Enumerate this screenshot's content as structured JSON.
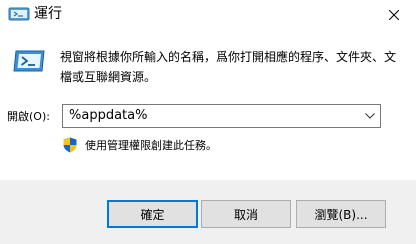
{
  "window": {
    "title": "運行",
    "close_label": "×"
  },
  "dialog": {
    "description": "視窗將根據你所輸入的名稱，爲你打開相應的程序、文件夾、文檔或互聯網資源。",
    "open_label": "開啟(O):",
    "open_value": "%appdata%",
    "admin_note": "使用管理權限創建此任務。"
  },
  "buttons": {
    "ok": "確定",
    "cancel": "取消",
    "browse": "瀏覽(B)..."
  },
  "colors": {
    "accent": "#0078d7",
    "footer_bg": "#f0f0f0",
    "button_bg": "#e1e1e1"
  },
  "icons": {
    "title": "run-icon",
    "main": "run-icon",
    "shield": "uac-shield-icon",
    "dropdown": "chevron-down-icon",
    "close": "close-icon"
  }
}
